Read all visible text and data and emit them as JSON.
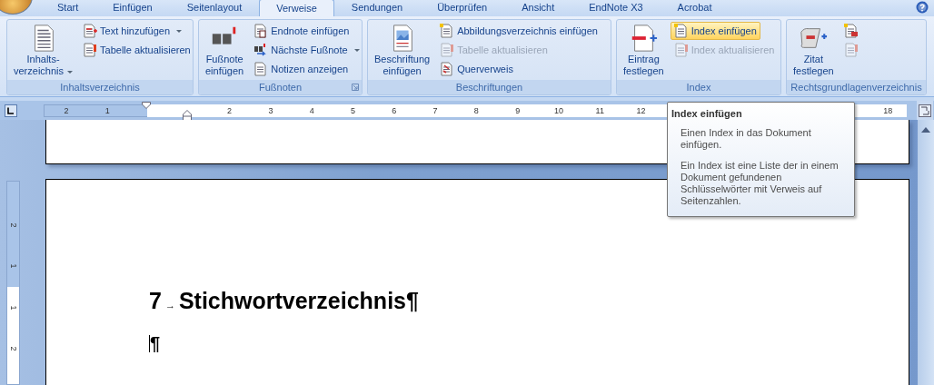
{
  "tabs": [
    {
      "label": "Start",
      "selected": false
    },
    {
      "label": "Einfügen",
      "selected": false
    },
    {
      "label": "Seitenlayout",
      "selected": false
    },
    {
      "label": "Verweise",
      "selected": true
    },
    {
      "label": "Sendungen",
      "selected": false
    },
    {
      "label": "Überprüfen",
      "selected": false
    },
    {
      "label": "Ansicht",
      "selected": false
    },
    {
      "label": "EndNote X3",
      "selected": false
    },
    {
      "label": "Acrobat",
      "selected": false
    }
  ],
  "ribbon_groups": [
    {
      "label": "Inhaltsverzeichnis",
      "dialog_launcher": false,
      "buttons": [
        {
          "kind": "large",
          "label": "Inhalts-\nverzeichnis",
          "dropdown": true,
          "disabled": false,
          "highlighted": false
        },
        {
          "kind": "small",
          "label": "Text hinzufügen",
          "dropdown": true,
          "disabled": false,
          "highlighted": false
        },
        {
          "kind": "small",
          "label": "Tabelle aktualisieren",
          "dropdown": false,
          "disabled": false,
          "highlighted": false
        }
      ]
    },
    {
      "label": "Fußnoten",
      "dialog_launcher": true,
      "buttons": [
        {
          "kind": "large",
          "label": "Fußnote\neinfügen",
          "dropdown": false,
          "disabled": false,
          "highlighted": false
        },
        {
          "kind": "small",
          "label": "Endnote einfügen",
          "dropdown": false,
          "disabled": false,
          "highlighted": false
        },
        {
          "kind": "small",
          "label": "Nächste Fußnote",
          "dropdown": true,
          "disabled": false,
          "highlighted": false
        },
        {
          "kind": "small",
          "label": "Notizen anzeigen",
          "dropdown": false,
          "disabled": false,
          "highlighted": false
        }
      ]
    },
    {
      "label": "Beschriftungen",
      "dialog_launcher": false,
      "buttons": [
        {
          "kind": "large",
          "label": "Beschriftung\neinfügen",
          "dropdown": false,
          "disabled": false,
          "highlighted": false
        },
        {
          "kind": "small",
          "label": "Abbildungsverzeichnis einfügen",
          "dropdown": false,
          "disabled": false,
          "highlighted": false
        },
        {
          "kind": "small",
          "label": "Tabelle aktualisieren",
          "dropdown": false,
          "disabled": true,
          "highlighted": false
        },
        {
          "kind": "small",
          "label": "Querverweis",
          "dropdown": false,
          "disabled": false,
          "highlighted": false
        }
      ]
    },
    {
      "label": "Index",
      "dialog_launcher": false,
      "buttons": [
        {
          "kind": "large",
          "label": "Eintrag\nfestlegen",
          "dropdown": false,
          "disabled": false,
          "highlighted": false
        },
        {
          "kind": "small",
          "label": "Index einfügen",
          "dropdown": false,
          "disabled": false,
          "highlighted": true
        },
        {
          "kind": "small",
          "label": "Index aktualisieren",
          "dropdown": false,
          "disabled": true,
          "highlighted": false
        }
      ]
    },
    {
      "label": "Rechtsgrundlagenverzeichnis",
      "dialog_launcher": false,
      "buttons": [
        {
          "kind": "large",
          "label": "Zitat\nfestlegen",
          "dropdown": false,
          "disabled": false,
          "highlighted": false
        },
        {
          "kind": "icon",
          "dropdown": false,
          "disabled": false,
          "highlighted": false
        },
        {
          "kind": "icon",
          "dropdown": false,
          "disabled": true,
          "highlighted": false
        }
      ]
    }
  ],
  "ruler": {
    "left_labels": [
      "2",
      "1"
    ],
    "right_labels": [
      "2",
      "3",
      "4",
      "5",
      "6",
      "7",
      "8",
      "9",
      "10",
      "11",
      "12"
    ],
    "far_labels": [
      "18"
    ]
  },
  "vertical_ruler": {
    "top_labels": [
      "2",
      "1"
    ],
    "bottom_labels": [
      "1",
      "2"
    ]
  },
  "document": {
    "heading_number": "7",
    "tab_mark": "→",
    "heading": "Stichwortverzeichnis",
    "heading_mark": "¶",
    "empty_paragraph_mark": "¶"
  },
  "tooltip": {
    "title": "Index einfügen",
    "paragraphs": [
      "Einen Index in das Dokument einfügen.",
      "Ein Index ist eine Liste der in einem Dokument gefundenen Schlüsselwörter mit Verweis auf Seitenzahlen."
    ]
  }
}
